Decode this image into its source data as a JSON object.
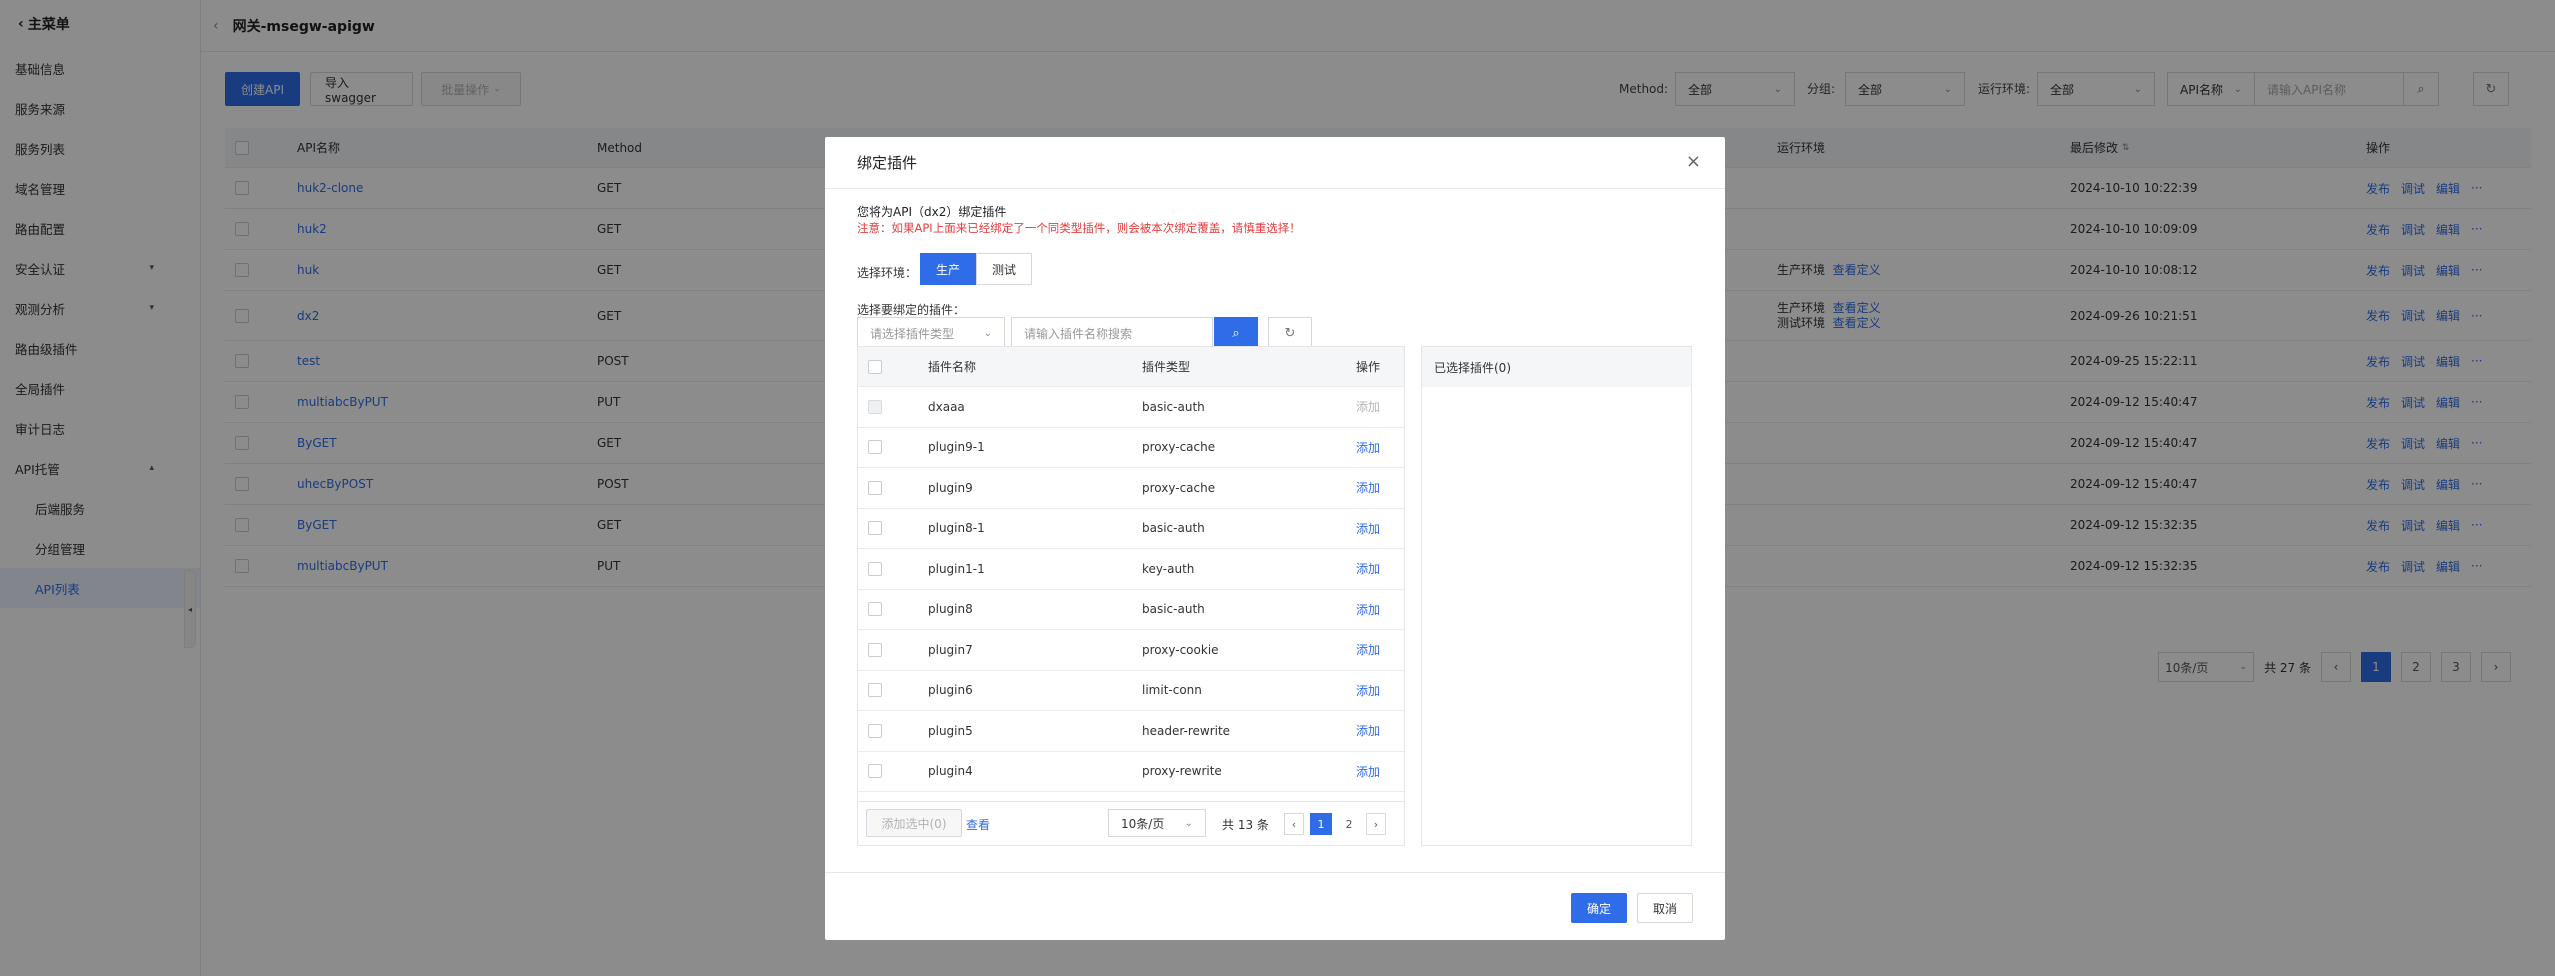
{
  "sidebar": {
    "back_label": "主菜单",
    "items": [
      {
        "label": "基础信息"
      },
      {
        "label": "服务来源"
      },
      {
        "label": "服务列表"
      },
      {
        "label": "域名管理"
      },
      {
        "label": "路由配置"
      },
      {
        "label": "安全认证",
        "arrow": "▾"
      },
      {
        "label": "观测分析",
        "arrow": "▾"
      },
      {
        "label": "路由级插件"
      },
      {
        "label": "全局插件"
      },
      {
        "label": "审计日志"
      },
      {
        "label": "API托管",
        "arrow": "▴"
      },
      {
        "label": "后端服务"
      },
      {
        "label": "分组管理"
      },
      {
        "label": "API列表"
      }
    ]
  },
  "header": {
    "title": "网关-msegw-apigw"
  },
  "toolbar": {
    "create": "创建API",
    "import": "导入swagger",
    "batch": "批量操作",
    "method_label": "Method:",
    "method_value": "全部",
    "group_label": "分组:",
    "group_value": "全部",
    "env_label": "运行环境:",
    "env_value": "全部",
    "search_type": "API名称",
    "search_placeholder": "请输入API名称"
  },
  "table": {
    "headers": {
      "name": "API名称",
      "method": "Method",
      "env": "运行环境",
      "modified": "最后修改",
      "ops": "操作"
    },
    "ops": {
      "publish": "发布",
      "debug": "调试",
      "edit": "编辑",
      "more": "···"
    },
    "rows": [
      {
        "name": "huk2-clone",
        "method": "GET",
        "env1": "",
        "env2": "",
        "env1_link": "",
        "env2_link": "",
        "modified": "2024-10-10 10:22:39"
      },
      {
        "name": "huk2",
        "method": "GET",
        "env1": "",
        "env2": "",
        "env1_link": "",
        "env2_link": "",
        "modified": "2024-10-10 10:09:09"
      },
      {
        "name": "huk",
        "method": "GET",
        "env1": "生产环境",
        "env2": "",
        "env1_link": "查看定义",
        "env2_link": "",
        "modified": "2024-10-10 10:08:12"
      },
      {
        "name": "dx2",
        "method": "GET",
        "env1": "生产环境",
        "env2": "测试环境",
        "env1_link": "查看定义",
        "env2_link": "查看定义",
        "modified": "2024-09-26 10:21:51"
      },
      {
        "name": "test",
        "method": "POST",
        "env1": "",
        "env2": "",
        "env1_link": "",
        "env2_link": "",
        "modified": "2024-09-25 15:22:11"
      },
      {
        "name": "multiabcByPUT",
        "method": "PUT",
        "env1": "",
        "env2": "",
        "env1_link": "",
        "env2_link": "",
        "modified": "2024-09-12 15:40:47"
      },
      {
        "name": "ByGET",
        "method": "GET",
        "env1": "",
        "env2": "",
        "env1_link": "",
        "env2_link": "",
        "modified": "2024-09-12 15:40:47"
      },
      {
        "name": "uhecByPOST",
        "method": "POST",
        "env1": "",
        "env2": "",
        "env1_link": "",
        "env2_link": "",
        "modified": "2024-09-12 15:40:47"
      },
      {
        "name": "ByGET",
        "method": "GET",
        "env1": "",
        "env2": "",
        "env1_link": "",
        "env2_link": "",
        "modified": "2024-09-12 15:32:35"
      },
      {
        "name": "multiabcByPUT",
        "method": "PUT",
        "env1": "",
        "env2": "",
        "env1_link": "",
        "env2_link": "",
        "modified": "2024-09-12 15:32:35"
      }
    ]
  },
  "pager": {
    "size": "10条/页",
    "total": "共 27 条",
    "pages": [
      "1",
      "2",
      "3"
    ],
    "prev": "‹",
    "next": "›"
  },
  "modal": {
    "title": "绑定插件",
    "close": "×",
    "intro": "您将为API（dx2）绑定插件",
    "warning": "注意：如果API上面来已经绑定了一个同类型插件，则会被本次绑定覆盖，请慎重选择！",
    "env_label": "选择环境：",
    "env_prod": "生产",
    "env_test": "测试",
    "select_label": "选择要绑定的插件：",
    "type_placeholder": "请选择插件类型",
    "name_placeholder": "请输入插件名称搜索",
    "cols": {
      "name": "插件名称",
      "type": "插件类型",
      "op": "操作"
    },
    "add": "添加",
    "plugins": [
      {
        "name": "dxaaa",
        "type": "basic-auth",
        "disabled": true
      },
      {
        "name": "plugin9-1",
        "type": "proxy-cache",
        "disabled": false
      },
      {
        "name": "plugin9",
        "type": "proxy-cache",
        "disabled": false
      },
      {
        "name": "plugin8-1",
        "type": "basic-auth",
        "disabled": false
      },
      {
        "name": "plugin1-1",
        "type": "key-auth",
        "disabled": false
      },
      {
        "name": "plugin8",
        "type": "basic-auth",
        "disabled": false
      },
      {
        "name": "plugin7",
        "type": "proxy-cookie",
        "disabled": false
      },
      {
        "name": "plugin6",
        "type": "limit-conn",
        "disabled": false
      },
      {
        "name": "plugin5",
        "type": "header-rewrite",
        "disabled": false
      },
      {
        "name": "plugin4",
        "type": "proxy-rewrite",
        "disabled": false
      }
    ],
    "add_selected": "添加选中(0)",
    "view": "查看",
    "page_size": "10条/页",
    "total": "共 13 条",
    "pages": [
      "1",
      "2"
    ],
    "selected_title": "已选择插件(0)",
    "ok": "确定",
    "cancel": "取消"
  }
}
